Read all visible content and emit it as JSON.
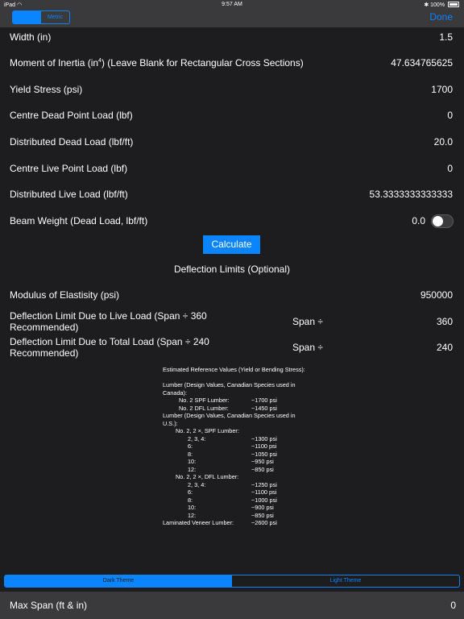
{
  "status": {
    "device": "iPad",
    "time": "9:57 AM",
    "battery": "100%"
  },
  "nav": {
    "seg_left": "Imperial",
    "seg_right": "Metric",
    "done": "Done"
  },
  "inputs": {
    "width": {
      "label": "Width (in)",
      "value": "1.5"
    },
    "moment_label_a": "Moment of Inertia (in",
    "moment_sup": "4",
    "moment_label_b": ") (Leave Blank for Rectangular Cross Sections)",
    "moment_value": "47.634765625",
    "yield": {
      "label": "Yield Stress (psi)",
      "value": "1700"
    },
    "centre_dead": {
      "label": "Centre Dead Point Load (lbf)",
      "value": "0"
    },
    "dist_dead": {
      "label": "Distributed Dead Load (lbf/ft)",
      "value": "20.0"
    },
    "centre_live": {
      "label": "Centre Live Point Load (lbf)",
      "value": "0"
    },
    "dist_live": {
      "label": "Distributed Live Load (lbf/ft)",
      "value": "53.3333333333333"
    },
    "beam_weight": {
      "label": "Beam Weight (Dead Load, lbf/ft)",
      "value": "0.0"
    }
  },
  "calculate": "Calculate",
  "deflection": {
    "title": "Deflection Limits (Optional)",
    "modulus": {
      "label": "Modulus of Elastisity (psi)",
      "value": "950000"
    },
    "live": {
      "label": "Deflection Limit Due to Live Load (Span ÷ 360 Recommended)",
      "prefix": "Span ÷",
      "value": "360"
    },
    "total": {
      "label": "Deflection Limit Due to Total Load (Span ÷ 240 Recommended)",
      "prefix": "Span ÷",
      "value": "240"
    }
  },
  "reference": {
    "heading": "Estimated Reference Values (Yield or Bending Stress):",
    "canada_heading": "Lumber (Design Values, Canadian Species used in Canada):",
    "canada": [
      {
        "name": "No. 2 SPF Lumber:",
        "value": "~1700 psi"
      },
      {
        "name": "No. 2 DFL Lumber:",
        "value": "~1450 psi"
      }
    ],
    "us_heading": "Lumber (Design Values, Canadian Species used in U.S.):",
    "spf_heading": "No. 2, 2 ×, SPF Lumber:",
    "spf": [
      {
        "name": "2, 3,  4:",
        "value": "~1300 psi"
      },
      {
        "name": "6:",
        "value": "~1100 psi"
      },
      {
        "name": "8:",
        "value": "~1050 psi"
      },
      {
        "name": "10:",
        "value": "~950 psi"
      },
      {
        "name": "12:",
        "value": "~850 psi"
      }
    ],
    "dfl_heading": "No. 2, 2 ×, DFL Lumber:",
    "dfl": [
      {
        "name": "2, 3,  4:",
        "value": "~1250 psi"
      },
      {
        "name": "6:",
        "value": "~1100 psi"
      },
      {
        "name": "8:",
        "value": "~1000 psi"
      },
      {
        "name": "10:",
        "value": "~900 psi"
      },
      {
        "name": "12:",
        "value": "~850 psi"
      }
    ],
    "lvl": {
      "name": "Laminated Veneer Lumber:",
      "value": "~2600 psi"
    }
  },
  "theme": {
    "dark": "Dark Theme",
    "light": "Light Theme"
  },
  "result": {
    "label": "Max Span (ft & in)",
    "value": "0"
  },
  "colors": {
    "accent": "#0a84ff",
    "background": "#1d1d1f",
    "bar": "#3a3a3c"
  }
}
